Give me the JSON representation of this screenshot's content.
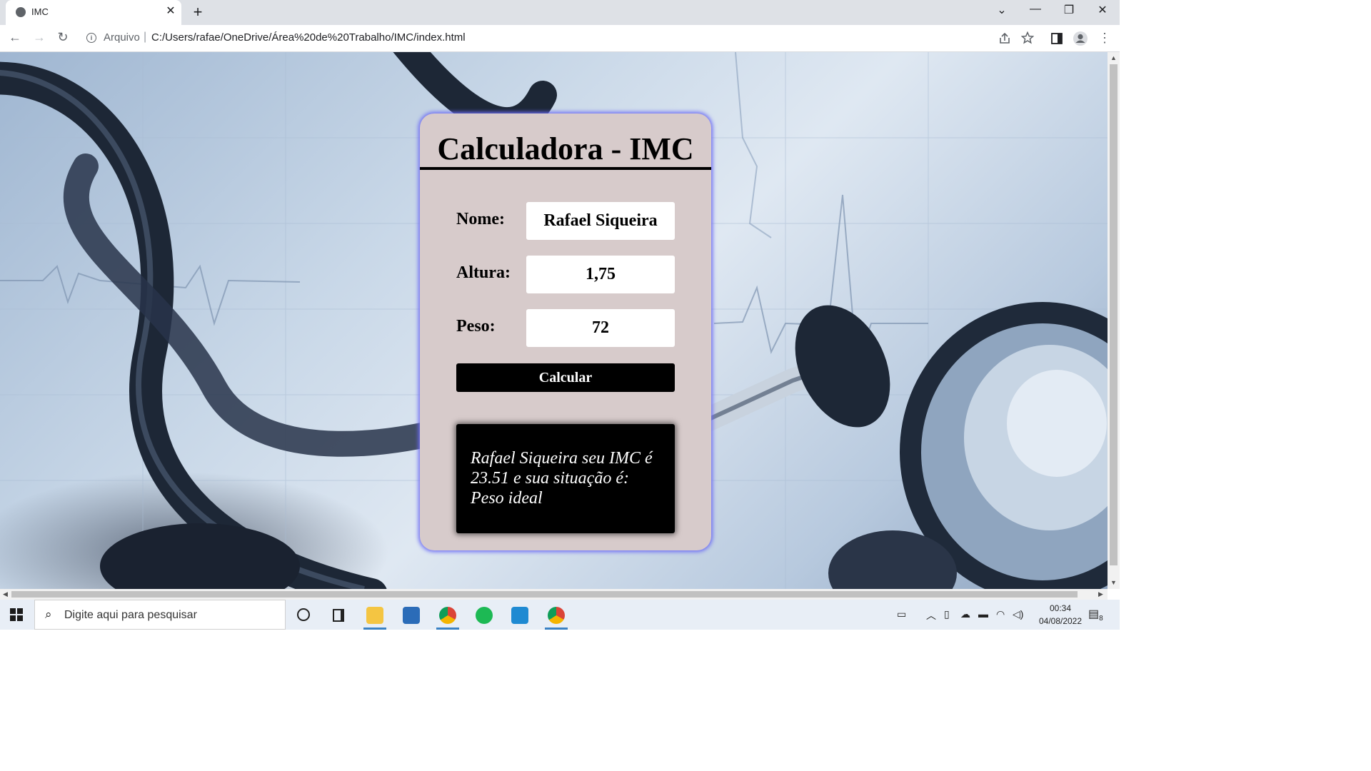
{
  "browser": {
    "tab_title": "IMC",
    "tab_close": "✕",
    "new_tab": "+",
    "scheme_label": "Arquivo",
    "url": "C:/Users/rafae/OneDrive/Área%20de%20Trabalho/IMC/index.html",
    "window_controls": {
      "dropdown": "⌄",
      "minimize": "—",
      "restore": "❐",
      "close": "✕"
    }
  },
  "card": {
    "title": "Calculadora - IMC",
    "fields": {
      "nome": {
        "label": "Nome:",
        "value": "Rafael Siqueira"
      },
      "altura": {
        "label": "Altura:",
        "value": "1,75"
      },
      "peso": {
        "label": "Peso:",
        "value": "72"
      }
    },
    "button_label": "Calcular",
    "result_text": "Rafael Siqueira seu IMC é 23.51 e sua situação é: Peso ideal"
  },
  "taskbar": {
    "search_placeholder": "Digite aqui para pesquisar",
    "time": "00:34",
    "date": "04/08/2022",
    "notification_count": "8"
  },
  "colors": {
    "card_bg": "#d7cbcb",
    "card_glow": "#6b6bf5",
    "button_bg": "#000000",
    "result_bg": "#000000"
  }
}
